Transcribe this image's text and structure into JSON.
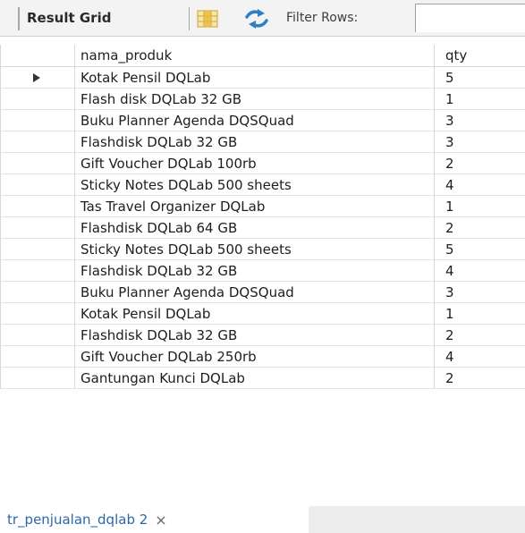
{
  "toolbar": {
    "result_grid_label": "Result Grid",
    "filter_label": "Filter Rows:",
    "filter_value": ""
  },
  "grid": {
    "columns": [
      "nama_produk",
      "qty"
    ],
    "rows": [
      {
        "nama_produk": "Kotak Pensil DQLab",
        "qty": "5"
      },
      {
        "nama_produk": "Flash disk DQLab 32 GB",
        "qty": "1"
      },
      {
        "nama_produk": "Buku Planner Agenda DQSQuad",
        "qty": "3"
      },
      {
        "nama_produk": "Flashdisk DQLab 32 GB",
        "qty": "3"
      },
      {
        "nama_produk": "Gift Voucher DQLab 100rb",
        "qty": "2"
      },
      {
        "nama_produk": "Sticky Notes DQLab 500 sheets",
        "qty": "4"
      },
      {
        "nama_produk": "Tas Travel Organizer DQLab",
        "qty": "1"
      },
      {
        "nama_produk": "Flashdisk DQLab 64 GB",
        "qty": "2"
      },
      {
        "nama_produk": "Sticky Notes DQLab 500 sheets",
        "qty": "5"
      },
      {
        "nama_produk": "Flashdisk DQLab 32 GB",
        "qty": "4"
      },
      {
        "nama_produk": "Buku Planner Agenda DQSQuad",
        "qty": "3"
      },
      {
        "nama_produk": "Kotak Pensil DQLab",
        "qty": "1"
      },
      {
        "nama_produk": "Flashdisk DQLab 32 GB",
        "qty": "2"
      },
      {
        "nama_produk": "Gift Voucher DQLab 250rb",
        "qty": "4"
      },
      {
        "nama_produk": "Gantungan Kunci DQLab",
        "qty": "2"
      }
    ]
  },
  "tabs": [
    {
      "label": "tr_penjualan_dqlab 2",
      "close": "×"
    }
  ],
  "icons": {
    "grid": "grid-view-icon",
    "refresh": "refresh-icon",
    "pointer": "row-pointer-icon"
  },
  "colors": {
    "tab_text": "#2b67a8"
  }
}
